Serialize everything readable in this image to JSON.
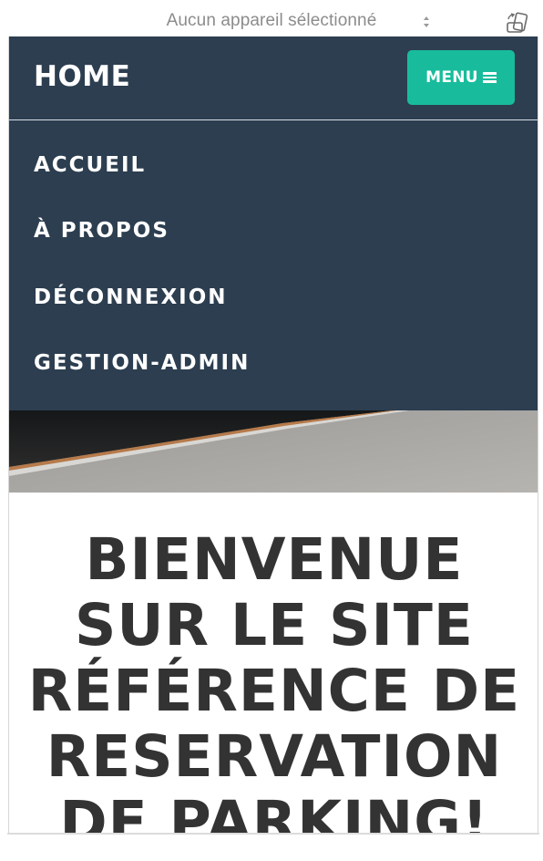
{
  "device_toolbar": {
    "device_select_value": "Aucun appareil sélectionné",
    "rotate_icon": "rotate-device-icon"
  },
  "navbar": {
    "brand": "HOME",
    "menu_button_label": "MENU",
    "menu_icon": "hamburger-icon"
  },
  "nav_menu": {
    "items": [
      {
        "label": "ACCUEIL"
      },
      {
        "label": "À PROPOS"
      },
      {
        "label": "DÉCONNEXION"
      },
      {
        "label": "GESTION-ADMIN"
      }
    ]
  },
  "hero": {
    "headline": "BIENVENUE SUR LE SITE RÉFÉRENCE DE RESERVATION DE PARKING!"
  },
  "colors": {
    "navbar_bg": "#2c3e50",
    "menu_button_bg": "#18bc9c",
    "headline_text": "#333333"
  }
}
